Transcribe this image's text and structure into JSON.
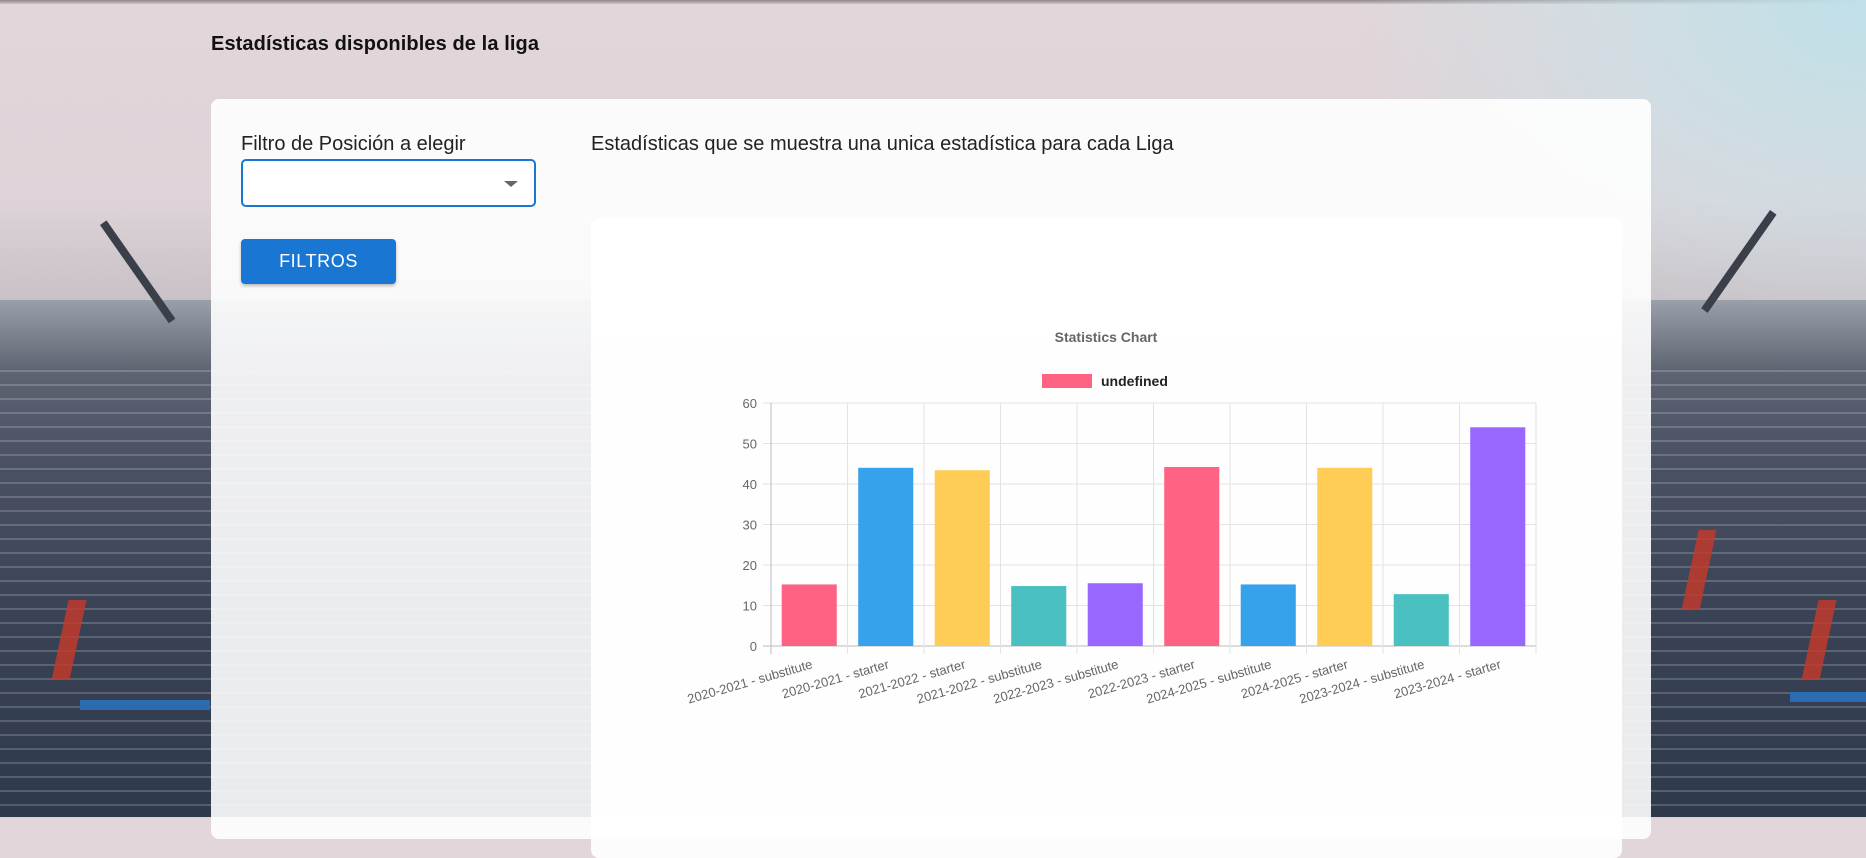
{
  "page": {
    "title": "Estadísticas disponibles de la liga"
  },
  "filters": {
    "position_label": "Filtro de Posición a elegir",
    "position_value": "",
    "submit_label": "FILTROS"
  },
  "stats": {
    "description": "Estadísticas que se muestra una unica estadística para cada Liga"
  },
  "icons": {
    "select_caret": "chevron-down-icon"
  },
  "colors": {
    "primary": "#1976d2",
    "bar_pink": "#ff6384",
    "bar_blue": "#36a2eb",
    "bar_yellow": "#ffcd56",
    "bar_teal": "#4bc0c0",
    "bar_purple": "#9966ff"
  },
  "chart_data": {
    "type": "bar",
    "title": "Statistics Chart",
    "legend": {
      "label": "undefined",
      "position": "top",
      "color": "#ff6384"
    },
    "categories": [
      "2020-2021 - substitute",
      "2020-2021 - starter",
      "2021-2022 - starter",
      "2021-2022 - substitute",
      "2022-2023 - substitute",
      "2022-2023 - starter",
      "2024-2025 - substitute",
      "2024-2025 - starter",
      "2023-2024 - substitute",
      "2023-2024 - starter"
    ],
    "values": [
      15.2,
      44,
      43.4,
      14.8,
      15.5,
      44.2,
      15.2,
      44,
      12.8,
      54
    ],
    "colors": [
      "#ff6384",
      "#36a2eb",
      "#ffcd56",
      "#4bc0c0",
      "#9966ff",
      "#ff6384",
      "#36a2eb",
      "#ffcd56",
      "#4bc0c0",
      "#9966ff"
    ],
    "ylim": [
      0,
      60
    ],
    "yticks": [
      0,
      10,
      20,
      30,
      40,
      50,
      60
    ],
    "grid": true,
    "xlabel": "",
    "ylabel": ""
  }
}
